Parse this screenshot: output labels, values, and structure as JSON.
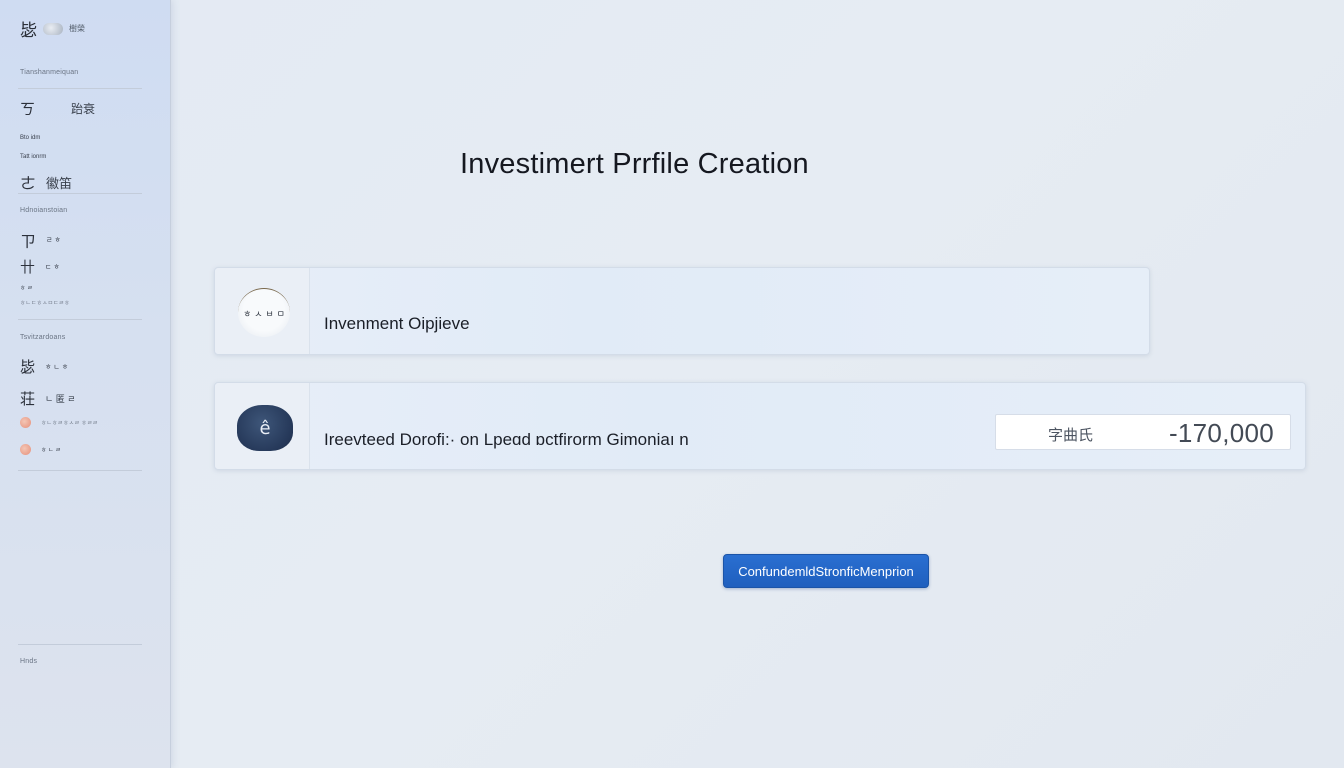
{
  "sidebar": {
    "logo_glyph": "毖",
    "logo_small": "樹榮",
    "sections": [
      {
        "label": "Tianshanmeiquan"
      },
      {
        "label": "Hdnoianstoian"
      },
      {
        "label": "Tsvitzardoans"
      }
    ],
    "items": [
      {
        "icon": "ㄎ",
        "label": "跆衰",
        "sub": ""
      },
      {
        "icon": "",
        "label": "Bto idm",
        "sub": ""
      },
      {
        "icon": "",
        "label": "Tatt ionrm",
        "sub": ""
      },
      {
        "icon": "㠀",
        "label": "徽笛",
        "sub": ""
      },
      {
        "icon": "ㄗ",
        "label": "ㄹ ㅎ",
        "sub": ""
      },
      {
        "icon": "卄",
        "label": "ㄷ ㅎ",
        "sub": ""
      },
      {
        "icon": "",
        "label": "ㅎ ㄹ",
        "sub": "ㅎㄴㄷㅎㅅㅁㄷㄹㅎ"
      },
      {
        "icon": "毖",
        "label": "ㅎ ㄴ ㅎ",
        "sub": ""
      },
      {
        "icon": "荘",
        "label": "ㄴ 匿 ㄹ",
        "sub": ""
      },
      {
        "icon": "",
        "label": "",
        "sub": "ㅎㄴㅎㄹㅎㅅㄹ ㅎㄹㄹ"
      },
      {
        "icon": "",
        "label": "ㅎ ㄴ ㄹ",
        "sub": ""
      }
    ],
    "footer": "Hnds"
  },
  "main": {
    "title": "Investimert Prrfile Creation",
    "objective_label": "Invenment Oipjieve",
    "objective_icon_text": "ㅎ ㅅ ㅂ ㅁ",
    "horizon_label": "Ireevteed Dorofi:· on Lpeɑd ɒctfirorm Gimoniaı n",
    "horizon_icon_text": "ê",
    "amount_prefix": "字曲氏",
    "amount_value": "-170,000",
    "confirm_label": "ConfundemldStronficMenprion"
  }
}
